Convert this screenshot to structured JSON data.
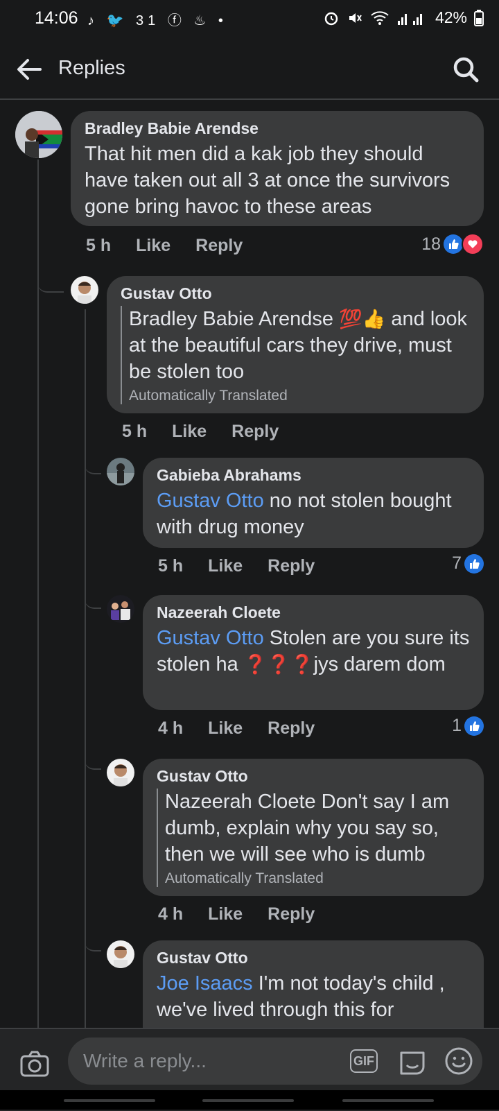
{
  "status_bar": {
    "time": "14:06",
    "app_icons": "♪ 🐦 31 ⓕ ♨ •",
    "battery": "42%"
  },
  "header": {
    "title": "Replies"
  },
  "comments": [
    {
      "author": "Bradley Babie Arendse",
      "text": "That hit men did a kak job they should have taken out all 3 at once the survivors gone bring havoc to these areas",
      "time": "5 h",
      "like": "Like",
      "reply": "Reply",
      "reactions": "18"
    },
    {
      "author": "Gustav Otto",
      "text_pre": "Bradley Babie Arendse ",
      "emojis": "💯👍",
      "text_post": " and look at the beautiful cars they drive, must be stolen too",
      "translated": "Automatically Translated",
      "time": "5 h",
      "like": "Like",
      "reply": "Reply"
    },
    {
      "author": "Gabieba Abrahams",
      "mention": "Gustav Otto",
      "text": " no not stolen bought with drug money",
      "time": "5 h",
      "like": "Like",
      "reply": "Reply",
      "reactions": "7"
    },
    {
      "author": "Nazeerah Cloete",
      "mention": "Gustav Otto",
      "text_pre": " Stolen are you sure its stolen ha ",
      "emojis": "❓❓❓",
      "text_post": "jys darem dom",
      "time": "4 h",
      "like": "Like",
      "reply": "Reply",
      "reactions": "1"
    },
    {
      "author": "Gustav Otto",
      "text": "Nazeerah Cloete Don't say I am dumb, explain why you say so, then we will see who is dumb",
      "translated": "Automatically Translated",
      "time": "4 h",
      "like": "Like",
      "reply": "Reply"
    },
    {
      "author": "Gustav Otto",
      "mention": "Joe Isaacs",
      "text": "  I'm not today's child , we've lived through this for"
    }
  ],
  "composer": {
    "placeholder": "Write a reply...",
    "gif_label": "GIF"
  },
  "colors": {
    "background": "#18191a",
    "bubble": "#3a3b3c",
    "mention": "#5c9df5",
    "like_blue": "#2374e1",
    "love_red": "#f33e58"
  }
}
